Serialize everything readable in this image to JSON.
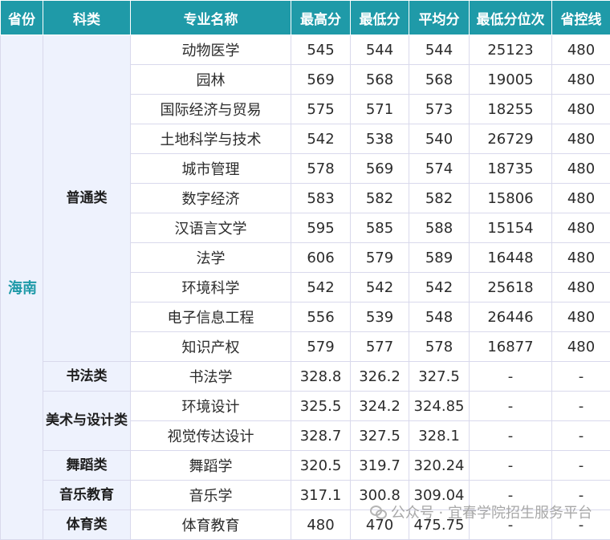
{
  "headers": [
    "省份",
    "科类",
    "专业名称",
    "最高分",
    "最低分",
    "平均分",
    "最低分位次",
    "省控线"
  ],
  "province": "海南",
  "categories": {
    "putong": "普通类",
    "shufa": "书法类",
    "meishu": "美术与设计类",
    "wudao": "舞蹈类",
    "yinyue": "音乐教育",
    "tiyu": "体育类"
  },
  "rows": [
    {
      "major": "动物医学",
      "max": "545",
      "min": "544",
      "avg": "544",
      "rank": "25123",
      "line": "480"
    },
    {
      "major": "园林",
      "max": "569",
      "min": "568",
      "avg": "568",
      "rank": "19005",
      "line": "480"
    },
    {
      "major": "国际经济与贸易",
      "max": "575",
      "min": "571",
      "avg": "573",
      "rank": "18255",
      "line": "480"
    },
    {
      "major": "土地科学与技术",
      "max": "542",
      "min": "538",
      "avg": "540",
      "rank": "26729",
      "line": "480"
    },
    {
      "major": "城市管理",
      "max": "578",
      "min": "569",
      "avg": "574",
      "rank": "18735",
      "line": "480"
    },
    {
      "major": "数字经济",
      "max": "583",
      "min": "582",
      "avg": "582",
      "rank": "15806",
      "line": "480"
    },
    {
      "major": "汉语言文学",
      "max": "595",
      "min": "585",
      "avg": "588",
      "rank": "15154",
      "line": "480"
    },
    {
      "major": "法学",
      "max": "606",
      "min": "579",
      "avg": "589",
      "rank": "16448",
      "line": "480"
    },
    {
      "major": "环境科学",
      "max": "542",
      "min": "542",
      "avg": "542",
      "rank": "25618",
      "line": "480"
    },
    {
      "major": "电子信息工程",
      "max": "556",
      "min": "539",
      "avg": "548",
      "rank": "26446",
      "line": "480"
    },
    {
      "major": "知识产权",
      "max": "579",
      "min": "577",
      "avg": "578",
      "rank": "16877",
      "line": "480"
    },
    {
      "major": "书法学",
      "max": "328.8",
      "min": "326.2",
      "avg": "327.5",
      "rank": "-",
      "line": "-"
    },
    {
      "major": "环境设计",
      "max": "325.5",
      "min": "324.2",
      "avg": "324.85",
      "rank": "-",
      "line": "-"
    },
    {
      "major": "视觉传达设计",
      "max": "328.7",
      "min": "327.5",
      "avg": "328.1",
      "rank": "-",
      "line": "-"
    },
    {
      "major": "舞蹈学",
      "max": "320.5",
      "min": "319.7",
      "avg": "320.24",
      "rank": "-",
      "line": "-"
    },
    {
      "major": "音乐学",
      "max": "317.1",
      "min": "300.8",
      "avg": "309.04",
      "rank": "-",
      "line": "-"
    },
    {
      "major": "体育教育",
      "max": "480",
      "min": "470",
      "avg": "475.75",
      "rank": "-",
      "line": "-"
    }
  ],
  "watermark": "公众号 · 宜春学院招生服务平台"
}
